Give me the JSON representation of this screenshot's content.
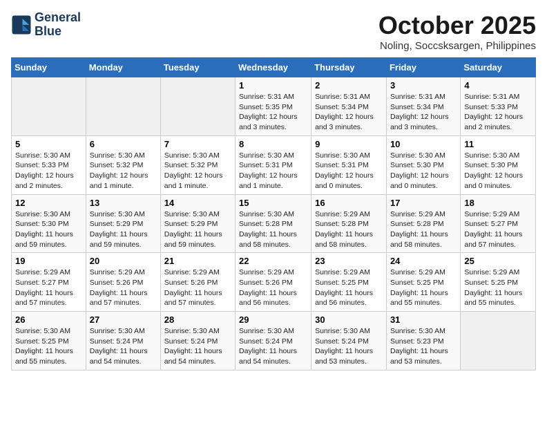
{
  "logo": {
    "line1": "General",
    "line2": "Blue"
  },
  "month": "October 2025",
  "location": "Noling, Soccsksargen, Philippines",
  "days_header": [
    "Sunday",
    "Monday",
    "Tuesday",
    "Wednesday",
    "Thursday",
    "Friday",
    "Saturday"
  ],
  "weeks": [
    [
      {
        "num": "",
        "info": ""
      },
      {
        "num": "",
        "info": ""
      },
      {
        "num": "",
        "info": ""
      },
      {
        "num": "1",
        "info": "Sunrise: 5:31 AM\nSunset: 5:35 PM\nDaylight: 12 hours and 3 minutes."
      },
      {
        "num": "2",
        "info": "Sunrise: 5:31 AM\nSunset: 5:34 PM\nDaylight: 12 hours and 3 minutes."
      },
      {
        "num": "3",
        "info": "Sunrise: 5:31 AM\nSunset: 5:34 PM\nDaylight: 12 hours and 3 minutes."
      },
      {
        "num": "4",
        "info": "Sunrise: 5:31 AM\nSunset: 5:33 PM\nDaylight: 12 hours and 2 minutes."
      }
    ],
    [
      {
        "num": "5",
        "info": "Sunrise: 5:30 AM\nSunset: 5:33 PM\nDaylight: 12 hours and 2 minutes."
      },
      {
        "num": "6",
        "info": "Sunrise: 5:30 AM\nSunset: 5:32 PM\nDaylight: 12 hours and 1 minute."
      },
      {
        "num": "7",
        "info": "Sunrise: 5:30 AM\nSunset: 5:32 PM\nDaylight: 12 hours and 1 minute."
      },
      {
        "num": "8",
        "info": "Sunrise: 5:30 AM\nSunset: 5:31 PM\nDaylight: 12 hours and 1 minute."
      },
      {
        "num": "9",
        "info": "Sunrise: 5:30 AM\nSunset: 5:31 PM\nDaylight: 12 hours and 0 minutes."
      },
      {
        "num": "10",
        "info": "Sunrise: 5:30 AM\nSunset: 5:30 PM\nDaylight: 12 hours and 0 minutes."
      },
      {
        "num": "11",
        "info": "Sunrise: 5:30 AM\nSunset: 5:30 PM\nDaylight: 12 hours and 0 minutes."
      }
    ],
    [
      {
        "num": "12",
        "info": "Sunrise: 5:30 AM\nSunset: 5:30 PM\nDaylight: 11 hours and 59 minutes."
      },
      {
        "num": "13",
        "info": "Sunrise: 5:30 AM\nSunset: 5:29 PM\nDaylight: 11 hours and 59 minutes."
      },
      {
        "num": "14",
        "info": "Sunrise: 5:30 AM\nSunset: 5:29 PM\nDaylight: 11 hours and 59 minutes."
      },
      {
        "num": "15",
        "info": "Sunrise: 5:30 AM\nSunset: 5:28 PM\nDaylight: 11 hours and 58 minutes."
      },
      {
        "num": "16",
        "info": "Sunrise: 5:29 AM\nSunset: 5:28 PM\nDaylight: 11 hours and 58 minutes."
      },
      {
        "num": "17",
        "info": "Sunrise: 5:29 AM\nSunset: 5:28 PM\nDaylight: 11 hours and 58 minutes."
      },
      {
        "num": "18",
        "info": "Sunrise: 5:29 AM\nSunset: 5:27 PM\nDaylight: 11 hours and 57 minutes."
      }
    ],
    [
      {
        "num": "19",
        "info": "Sunrise: 5:29 AM\nSunset: 5:27 PM\nDaylight: 11 hours and 57 minutes."
      },
      {
        "num": "20",
        "info": "Sunrise: 5:29 AM\nSunset: 5:26 PM\nDaylight: 11 hours and 57 minutes."
      },
      {
        "num": "21",
        "info": "Sunrise: 5:29 AM\nSunset: 5:26 PM\nDaylight: 11 hours and 57 minutes."
      },
      {
        "num": "22",
        "info": "Sunrise: 5:29 AM\nSunset: 5:26 PM\nDaylight: 11 hours and 56 minutes."
      },
      {
        "num": "23",
        "info": "Sunrise: 5:29 AM\nSunset: 5:25 PM\nDaylight: 11 hours and 56 minutes."
      },
      {
        "num": "24",
        "info": "Sunrise: 5:29 AM\nSunset: 5:25 PM\nDaylight: 11 hours and 55 minutes."
      },
      {
        "num": "25",
        "info": "Sunrise: 5:29 AM\nSunset: 5:25 PM\nDaylight: 11 hours and 55 minutes."
      }
    ],
    [
      {
        "num": "26",
        "info": "Sunrise: 5:30 AM\nSunset: 5:25 PM\nDaylight: 11 hours and 55 minutes."
      },
      {
        "num": "27",
        "info": "Sunrise: 5:30 AM\nSunset: 5:24 PM\nDaylight: 11 hours and 54 minutes."
      },
      {
        "num": "28",
        "info": "Sunrise: 5:30 AM\nSunset: 5:24 PM\nDaylight: 11 hours and 54 minutes."
      },
      {
        "num": "29",
        "info": "Sunrise: 5:30 AM\nSunset: 5:24 PM\nDaylight: 11 hours and 54 minutes."
      },
      {
        "num": "30",
        "info": "Sunrise: 5:30 AM\nSunset: 5:24 PM\nDaylight: 11 hours and 53 minutes."
      },
      {
        "num": "31",
        "info": "Sunrise: 5:30 AM\nSunset: 5:23 PM\nDaylight: 11 hours and 53 minutes."
      },
      {
        "num": "",
        "info": ""
      }
    ]
  ]
}
